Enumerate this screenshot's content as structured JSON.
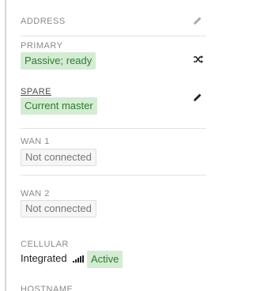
{
  "address": {
    "label": "ADDRESS",
    "edit_icon": "pencil-icon"
  },
  "primary": {
    "label": "PRIMARY",
    "status": "Passive; ready",
    "status_color": "#2f7a2f",
    "action_icon": "shuffle-icon"
  },
  "spare": {
    "label": "SPARE",
    "status": "Current master",
    "status_color": "#2f7a2f",
    "action_icon": "pencil-icon"
  },
  "wan1": {
    "label": "WAN 1",
    "status": "Not connected"
  },
  "wan2": {
    "label": "WAN 2",
    "status": "Not connected"
  },
  "cellular": {
    "label": "CELLULAR",
    "type": "Integrated",
    "signal_icon": "signal-bars-icon",
    "status": "Active"
  },
  "hostname": {
    "label": "HOSTNAME"
  }
}
